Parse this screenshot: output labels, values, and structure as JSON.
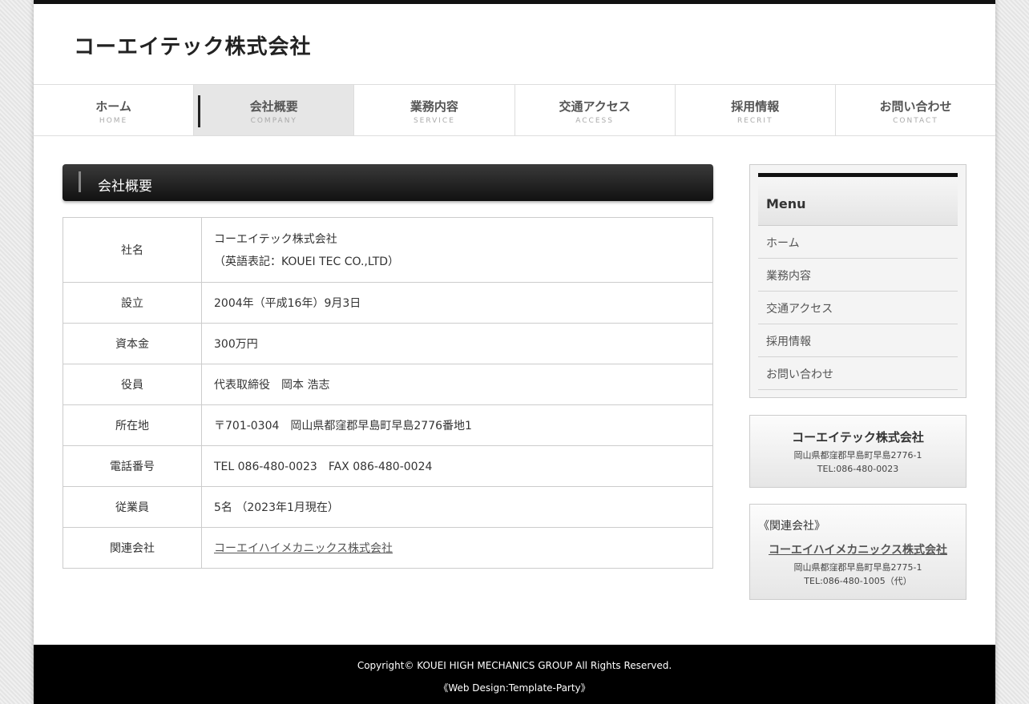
{
  "site": {
    "logo": "コーエイテック株式会社"
  },
  "nav": [
    {
      "jp": "ホーム",
      "en": "HOME"
    },
    {
      "jp": "会社概要",
      "en": "COMPANY"
    },
    {
      "jp": "業務内容",
      "en": "SERVICE"
    },
    {
      "jp": "交通アクセス",
      "en": "ACCESS"
    },
    {
      "jp": "採用情報",
      "en": "RECRIT"
    },
    {
      "jp": "お問い合わせ",
      "en": "CONTACT"
    }
  ],
  "main": {
    "heading": "会社概要",
    "rows": [
      {
        "label": "社名",
        "value": "コーエイテック株式会社",
        "value2": "（英語表記：KOUEI TEC CO.,LTD）"
      },
      {
        "label": "設立",
        "value": "2004年（平成16年）9月3日"
      },
      {
        "label": "資本金",
        "value": "300万円"
      },
      {
        "label": "役員",
        "value": "代表取締役　岡本 浩志"
      },
      {
        "label": "所在地",
        "value": "〒701-0304　岡山県都窪郡早島町早島2776番地1"
      },
      {
        "label": "電話番号",
        "value": "TEL 086-480-0023　FAX 086-480-0024"
      },
      {
        "label": "従業員",
        "value": "5名 （2023年1月現在）"
      },
      {
        "label": "関連会社",
        "value": "コーエイハイメカニックス株式会社"
      }
    ]
  },
  "sidebar": {
    "menu_title": "Menu",
    "menu_items": [
      "ホーム",
      "業務内容",
      "交通アクセス",
      "採用情報",
      "お問い合わせ"
    ],
    "company": {
      "name": "コーエイテック株式会社",
      "address": "岡山県都窪郡早島町早島2776-1",
      "tel": "TEL:086-480-0023"
    },
    "related": {
      "label": "《関連会社》",
      "name": "コーエイハイメカニックス株式会社",
      "address": "岡山県都窪郡早島町早島2775-1",
      "tel": "TEL:086-480-1005（代）"
    }
  },
  "footer": {
    "copyright": "Copyright© KOUEI HIGH MECHANICS GROUP All Rights Reserved.",
    "credit": "《Web Design:Template-Party》"
  }
}
